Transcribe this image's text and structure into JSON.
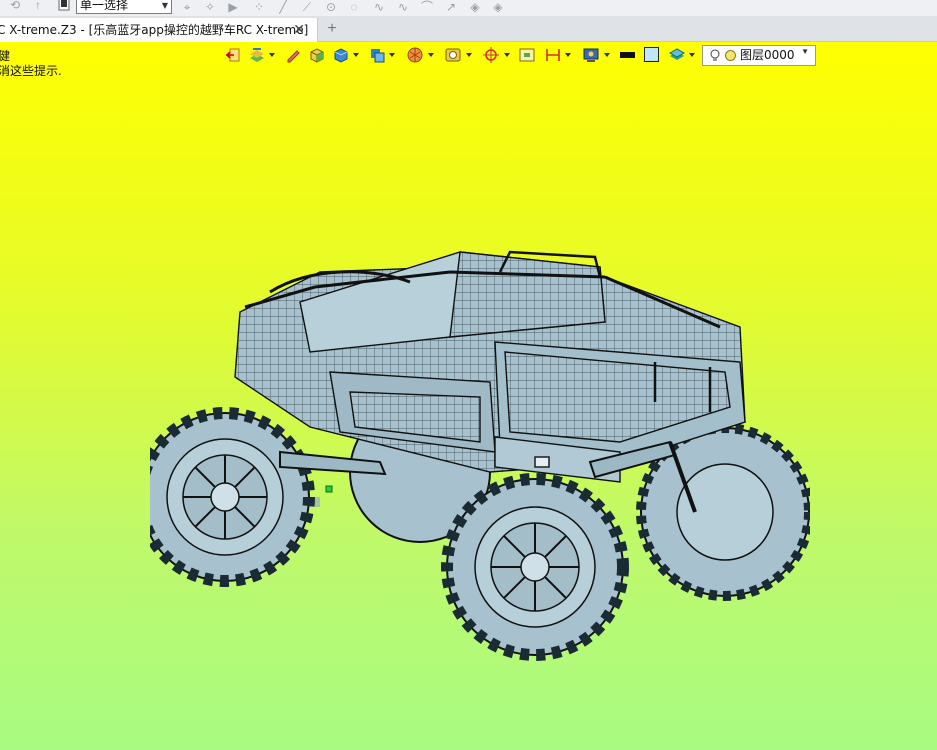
{
  "toolbar": {
    "selection_mode": "单一选择",
    "icons": [
      "undo-icon",
      "redo-icon",
      "stop-icon",
      "pick-icon",
      "filter-icon",
      "play-icon",
      "scatter-icon",
      "line-icon",
      "point-icon",
      "circle-icon",
      "curve-icon",
      "spline-icon",
      "arc-icon",
      "arrow-icon",
      "plane-icon",
      "plane2-icon"
    ]
  },
  "tabs": {
    "active_title": "C X-treme.Z3 - [乐高蓝牙app操控的越野车RC X-treme]",
    "close_symbol": "✕",
    "add_symbol": "+"
  },
  "viewport": {
    "hint_line1": "健",
    "hint_line2": "消这些提示.",
    "background_top": "#ffff00",
    "background_bottom": "#a8fa82"
  },
  "view_toolbar": {
    "layer_name": "图层0000",
    "buttons": [
      "exit-icon",
      "view-style-icon",
      "pen-icon",
      "cube-icon",
      "shaded-cube-icon",
      "display-mode-icon",
      "render-icon",
      "material-icon",
      "snap-icon",
      "frame-icon",
      "dimension-icon",
      "screen-icon",
      "line-color-swatch",
      "fill-color-swatch",
      "layer-stack-icon"
    ]
  },
  "model": {
    "name": "乐高蓝牙app操控的越野车RC X-treme",
    "color": "#a7c2ce"
  }
}
